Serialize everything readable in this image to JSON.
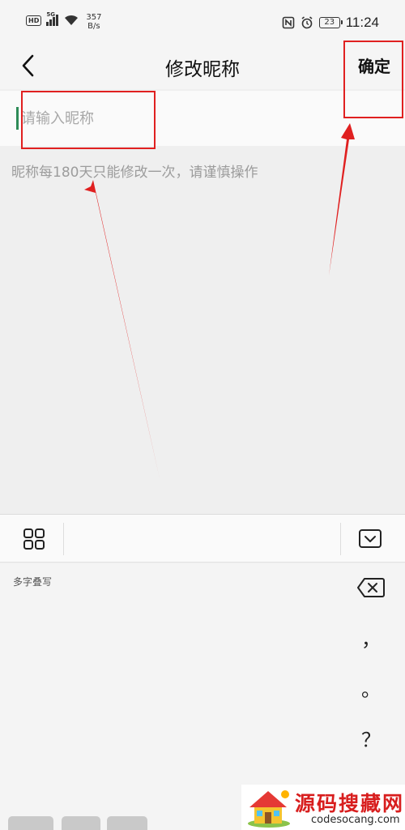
{
  "status_bar": {
    "hd_badge": "HD",
    "network_type": "5G",
    "net_speed_value": "357",
    "net_speed_unit": "B/s",
    "battery_level": "23",
    "time": "11:24",
    "icons": [
      "hd-icon",
      "signal-icon",
      "wifi-icon",
      "nfc-icon",
      "alarm-icon",
      "battery-icon"
    ]
  },
  "header": {
    "back_icon": "chevron-left-icon",
    "title": "修改昵称",
    "confirm_label": "确定"
  },
  "nickname": {
    "value": "",
    "placeholder": "请输入昵称",
    "hint": "昵称每180天只能修改一次，请谨慎操作"
  },
  "keyboard": {
    "toolbar_icons": [
      "grid-icon",
      "keyboard-hide-icon"
    ],
    "mode_label": "多字叠写",
    "side_keys": [
      "，",
      "。",
      "？"
    ],
    "backspace_icon": "backspace-icon"
  },
  "annotation": {
    "color": "#e02020"
  },
  "watermark": {
    "title": "源码搜藏网",
    "url": "codesocang.com"
  },
  "colors": {
    "caret": "#2e8b57",
    "hint": "#9c9c9c",
    "placeholder": "#a8a8a8",
    "watermark_red": "#d81e1e"
  }
}
